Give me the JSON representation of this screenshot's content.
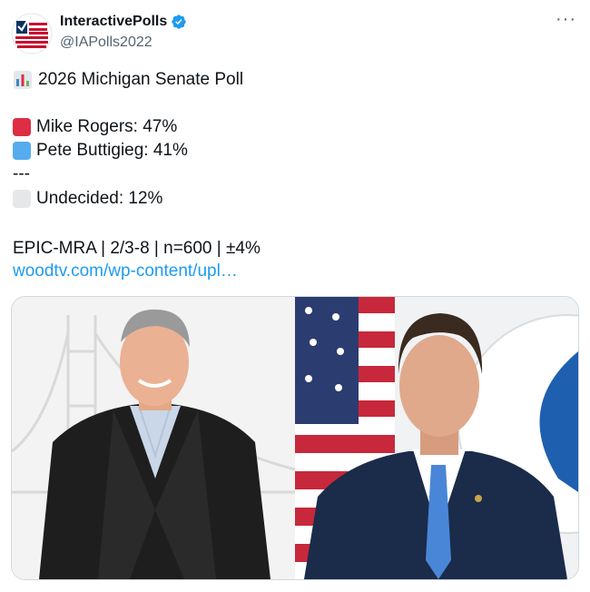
{
  "account": {
    "display_name": "InteractivePolls",
    "handle": "@IAPolls2022"
  },
  "tweet": {
    "title_emoji": "bar-chart-icon",
    "title": "2026 Michigan Senate Poll",
    "candidates": [
      {
        "label": "Mike Rogers: 47%",
        "color": "#dd2e44",
        "percent": 47
      },
      {
        "label": "Pete Buttigieg: 41%",
        "color": "#55acee",
        "percent": 41
      }
    ],
    "divider": "---",
    "undecided": {
      "label": "Undecided: 12%",
      "color": "#e6e7e8",
      "percent": 12
    },
    "source_line": "EPIC-MRA | 2/3-8 | n=600 | ±4%",
    "link_text": "woodtv.com/wp-content/upl…"
  },
  "colors": {
    "accent": "#1d9bf0",
    "text": "#0f1419",
    "secondary": "#536471",
    "verified_blue": "#1d9bf0"
  },
  "media": {
    "left_image": "photo-mike-rogers",
    "right_image": "photo-pete-buttigieg"
  }
}
